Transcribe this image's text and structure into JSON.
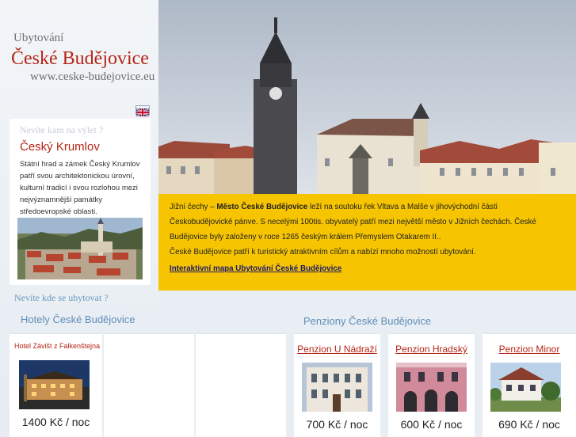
{
  "header": {
    "line1": "Ubytování",
    "line2": "České Budějovice",
    "url": "www.ceske-budejovice.eu"
  },
  "language_flag": {
    "icon": "uk-flag-icon"
  },
  "trip": {
    "heading": "Nevíte kam na výlet ?",
    "title": "Český Krumlov",
    "text": "Státní hrad a zámek Český Krumlov patří svou architektonickou úrovní, kulturní tradicí i svou rozlohou mezi nejvýznamnější památky středoevropské oblasti."
  },
  "stay": {
    "heading": "Nevíte kde se ubytovat ?"
  },
  "info": {
    "line1_pre": "Jižní čechy – ",
    "line1_bold": "Město České Budějovice",
    "line1_post": " leží na soutoku řek Vltava a Malše v jihovýchodní části",
    "line2": "Českobudějovické pánve. S necelými 100tis. obyvatelý patří mezi největší město v Jižních čechách. České",
    "line3": "Budějovice byly založeny v roce 1265 českým králem Přemyslem Otakarem II..",
    "line4": "České Budějovice patří k turistický atraktivním cílům a nabízí mnoho možností ubytování.",
    "link": "Interaktivní mapa Ubytování České Budějovice"
  },
  "hotels": {
    "heading": "Hotely České Budějovice",
    "items": [
      {
        "title": "Hotel Závišt z Falkenštejna",
        "price": "1400 Kč / noc"
      }
    ]
  },
  "pensions": {
    "heading": "Penziony České Budějovice",
    "items": [
      {
        "title": "Penzion U Nádraží",
        "price": "700 Kč / noc"
      },
      {
        "title": "Penzion Hradský",
        "price": "600 Kč / noc"
      },
      {
        "title": "Penzion Minor",
        "price": "690 Kč / noc"
      }
    ]
  },
  "colors": {
    "brand_red": "#b62416",
    "accent_blue": "#5d8db8",
    "info_yellow": "#f6c400"
  }
}
